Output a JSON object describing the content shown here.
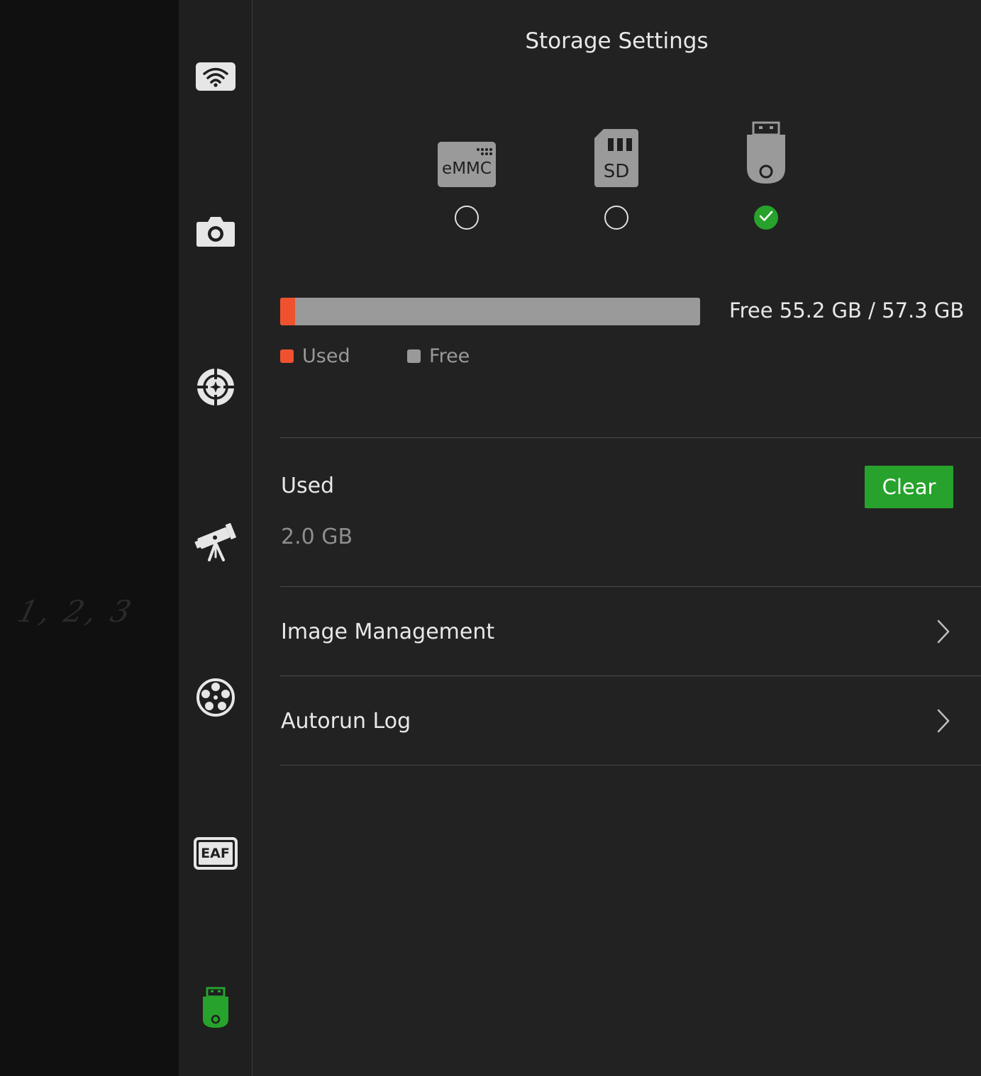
{
  "left_panel": {
    "handwriting": "1, 2, 3"
  },
  "sidebar": {
    "items": [
      {
        "name": "wifi",
        "icon": "wifi-icon"
      },
      {
        "name": "camera",
        "icon": "camera-icon"
      },
      {
        "name": "focus",
        "icon": "crosshair-icon"
      },
      {
        "name": "telescope",
        "icon": "telescope-icon"
      },
      {
        "name": "filter-wheel",
        "icon": "filter-wheel-icon"
      },
      {
        "name": "eaf",
        "icon": "eaf-icon",
        "label": "EAF"
      },
      {
        "name": "storage",
        "icon": "usb-drive-icon",
        "active": true
      }
    ],
    "active_color": "#27a22c"
  },
  "main": {
    "title": "Storage Settings",
    "storage_options": [
      {
        "id": "emmc",
        "label": "eMMC",
        "selected": false
      },
      {
        "id": "sd",
        "label": "SD",
        "selected": false
      },
      {
        "id": "usb",
        "label": "",
        "selected": true
      }
    ],
    "usage": {
      "used_fraction": 0.035,
      "free_text": "Free 55.2 GB / 57.3 GB",
      "legend_used": "Used",
      "legend_free": "Free",
      "used_color": "#f0522f",
      "free_color": "#9a9a9a"
    },
    "used_section": {
      "label": "Used",
      "value": "2.0 GB",
      "clear_label": "Clear"
    },
    "menu": [
      {
        "label": "Image Management"
      },
      {
        "label": "Autorun Log"
      }
    ]
  }
}
